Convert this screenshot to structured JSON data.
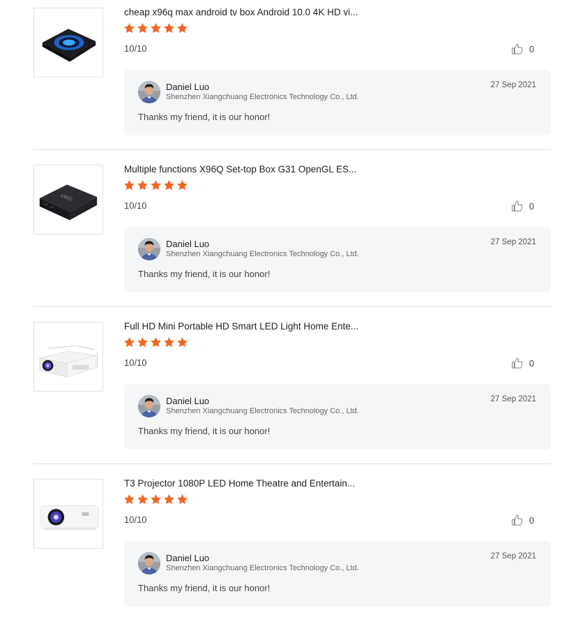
{
  "colors": {
    "star": "#f26522",
    "divider": "#dddddd",
    "reply_bg": "#f5f6f8"
  },
  "icons": {
    "star": "star-icon",
    "like": "thumbs-up-icon"
  },
  "reviews": [
    {
      "product_title": "cheap x96q max android tv box Android 10.0 4K HD vi...",
      "rating_stars": 5,
      "score": "10/10",
      "likes": "0",
      "reply": {
        "name": "Daniel Luo",
        "company": "Shenzhen Xiangchuang Electronics Technology Co., Ltd.",
        "date": "27 Sep 2021",
        "text": "Thanks my friend, it is our honor!"
      }
    },
    {
      "product_title": "Multiple functions X96Q Set-top Box G31 OpenGL ES...",
      "rating_stars": 5,
      "score": "10/10",
      "likes": "0",
      "reply": {
        "name": "Daniel Luo",
        "company": "Shenzhen Xiangchuang Electronics Technology Co., Ltd.",
        "date": "27 Sep 2021",
        "text": "Thanks my friend, it is our honor!"
      }
    },
    {
      "product_title": "Full HD Mini Portable HD Smart LED Light Home Ente...",
      "rating_stars": 5,
      "score": "10/10",
      "likes": "0",
      "reply": {
        "name": "Daniel Luo",
        "company": "Shenzhen Xiangchuang Electronics Technology Co., Ltd.",
        "date": "27 Sep 2021",
        "text": "Thanks my friend, it is our honor!"
      }
    },
    {
      "product_title": "T3 Projector 1080P LED Home Theatre and Entertain...",
      "rating_stars": 5,
      "score": "10/10",
      "likes": "0",
      "reply": {
        "name": "Daniel Luo",
        "company": "Shenzhen Xiangchuang Electronics Technology Co., Ltd.",
        "date": "27 Sep 2021",
        "text": "Thanks my friend, it is our honor!"
      }
    }
  ]
}
